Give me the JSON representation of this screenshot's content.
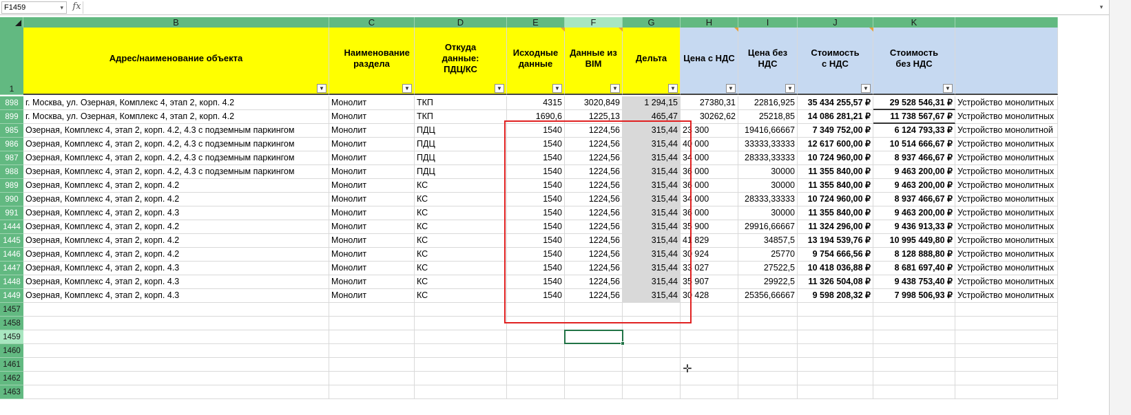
{
  "formula_bar": {
    "name_box": "F1459",
    "fx": "fx",
    "formula": ""
  },
  "columns": [
    "B",
    "C",
    "D",
    "E",
    "F",
    "G",
    "H",
    "I",
    "J",
    "K"
  ],
  "header_row_number": "1",
  "headers": {
    "B": "Адрес/наименование объекта",
    "C": "Наименование раздела",
    "D": "Откуда данные: ПДЦ/КС",
    "E": "Исходные данные",
    "F": "Данные из BIM",
    "G": "Дельта",
    "H": "Цена с НДС",
    "I": "Цена без НДС",
    "J": "Стоимость с НДС",
    "K": "Стоимость без НДС"
  },
  "rows": [
    {
      "n": "898",
      "b": "г. Москва, ул. Озерная, Комплекс 4, этап 2, корп. 4.2",
      "c": "Монолит",
      "d": "ТКП",
      "e": "4315",
      "f": "3020,849",
      "g": "1 294,15",
      "h": "27380,31",
      "i": "22816,925",
      "j": "35 434 255,57 ₽",
      "k": "29 528 546,31 ₽",
      "l": "Устройство монолитных"
    },
    {
      "n": "899",
      "b": "г. Москва, ул. Озерная, Комплекс 4, этап 2, корп. 4.2",
      "c": "Монолит",
      "d": "ТКП",
      "e": "1690,6",
      "f": "1225,13",
      "g": "465,47",
      "h": "30262,62",
      "i": "25218,85",
      "j": "14 086 281,21 ₽",
      "k": "11 738 567,67 ₽",
      "l": "Устройство монолитных"
    },
    {
      "n": "985",
      "b": "Озерная, Комплекс 4, этап 2, корп. 4.2, 4.3 с подземным паркингом",
      "c": "Монолит",
      "d": "ПДЦ",
      "e": "1540",
      "f": "1224,56",
      "g": "315,44",
      "h": "23 300",
      "i": "19416,66667",
      "j": "7 349 752,00 ₽",
      "k": "6 124 793,33 ₽",
      "l": "Устройство монолитной"
    },
    {
      "n": "986",
      "b": "Озерная, Комплекс 4, этап 2, корп. 4.2, 4.3 с подземным паркингом",
      "c": "Монолит",
      "d": "ПДЦ",
      "e": "1540",
      "f": "1224,56",
      "g": "315,44",
      "h": "40 000",
      "i": "33333,33333",
      "j": "12 617 600,00 ₽",
      "k": "10 514 666,67 ₽",
      "l": "Устройство монолитных"
    },
    {
      "n": "987",
      "b": "Озерная, Комплекс 4, этап 2, корп. 4.2, 4.3 с подземным паркингом",
      "c": "Монолит",
      "d": "ПДЦ",
      "e": "1540",
      "f": "1224,56",
      "g": "315,44",
      "h": "34 000",
      "i": "28333,33333",
      "j": "10 724 960,00 ₽",
      "k": "8 937 466,67 ₽",
      "l": "Устройство монолитных"
    },
    {
      "n": "988",
      "b": "Озерная, Комплекс 4, этап 2, корп. 4.2, 4.3 с подземным паркингом",
      "c": "Монолит",
      "d": "ПДЦ",
      "e": "1540",
      "f": "1224,56",
      "g": "315,44",
      "h": "36 000",
      "i": "30000",
      "j": "11 355 840,00 ₽",
      "k": "9 463 200,00 ₽",
      "l": "Устройство монолитных"
    },
    {
      "n": "989",
      "b": "Озерная, Комплекс 4, этап 2, корп. 4.2",
      "c": "Монолит",
      "d": "КС",
      "e": "1540",
      "f": "1224,56",
      "g": "315,44",
      "h": "36 000",
      "i": "30000",
      "j": "11 355 840,00 ₽",
      "k": "9 463 200,00 ₽",
      "l": "Устройство монолитных"
    },
    {
      "n": "990",
      "b": "Озерная, Комплекс 4, этап 2, корп. 4.2",
      "c": "Монолит",
      "d": "КС",
      "e": "1540",
      "f": "1224,56",
      "g": "315,44",
      "h": "34 000",
      "i": "28333,33333",
      "j": "10 724 960,00 ₽",
      "k": "8 937 466,67 ₽",
      "l": "Устройство монолитных"
    },
    {
      "n": "991",
      "b": "Озерная, Комплекс 4, этап 2, корп. 4.3",
      "c": "Монолит",
      "d": "КС",
      "e": "1540",
      "f": "1224,56",
      "g": "315,44",
      "h": "36 000",
      "i": "30000",
      "j": "11 355 840,00 ₽",
      "k": "9 463 200,00 ₽",
      "l": "Устройство монолитных"
    },
    {
      "n": "1444",
      "b": "Озерная, Комплекс 4, этап 2, корп. 4.2",
      "c": "Монолит",
      "d": "КС",
      "e": "1540",
      "f": "1224,56",
      "g": "315,44",
      "h": "35 900",
      "i": "29916,66667",
      "j": "11 324 296,00 ₽",
      "k": "9 436 913,33 ₽",
      "l": "Устройство монолитных"
    },
    {
      "n": "1445",
      "b": "Озерная, Комплекс 4, этап 2, корп. 4.2",
      "c": "Монолит",
      "d": "КС",
      "e": "1540",
      "f": "1224,56",
      "g": "315,44",
      "h": "41 829",
      "i": "34857,5",
      "j": "13 194 539,76 ₽",
      "k": "10 995 449,80 ₽",
      "l": "Устройство монолитных"
    },
    {
      "n": "1446",
      "b": "Озерная, Комплекс 4, этап 2, корп. 4.2",
      "c": "Монолит",
      "d": "КС",
      "e": "1540",
      "f": "1224,56",
      "g": "315,44",
      "h": "30 924",
      "i": "25770",
      "j": "9 754 666,56 ₽",
      "k": "8 128 888,80 ₽",
      "l": "Устройство монолитных"
    },
    {
      "n": "1447",
      "b": "Озерная, Комплекс 4, этап 2, корп. 4.3",
      "c": "Монолит",
      "d": "КС",
      "e": "1540",
      "f": "1224,56",
      "g": "315,44",
      "h": "33 027",
      "i": "27522,5",
      "j": "10 418 036,88 ₽",
      "k": "8 681 697,40 ₽",
      "l": "Устройство монолитных"
    },
    {
      "n": "1448",
      "b": "Озерная, Комплекс 4, этап 2, корп. 4.3",
      "c": "Монолит",
      "d": "КС",
      "e": "1540",
      "f": "1224,56",
      "g": "315,44",
      "h": "35 907",
      "i": "29922,5",
      "j": "11 326 504,08 ₽",
      "k": "9 438 753,40 ₽",
      "l": "Устройство монолитных"
    },
    {
      "n": "1449",
      "b": "Озерная, Комплекс 4, этап 2, корп. 4.3",
      "c": "Монолит",
      "d": "КС",
      "e": "1540",
      "f": "1224,56",
      "g": "315,44",
      "h": "30 428",
      "i": "25356,66667",
      "j": "9 598 208,32 ₽",
      "k": "7 998 506,93 ₽",
      "l": "Устройство монолитных"
    }
  ],
  "empty_rows": [
    "1457",
    "1458",
    "1459",
    "1460",
    "1461",
    "1462",
    "1463"
  ],
  "selected_row": "1459",
  "selected_column": "F",
  "colors": {
    "header_green": "#62b981",
    "header_yellow": "#ffff00",
    "header_blue": "#c6d9f1",
    "highlight_red": "#e02020",
    "delta_gray": "#d9d9d9"
  }
}
